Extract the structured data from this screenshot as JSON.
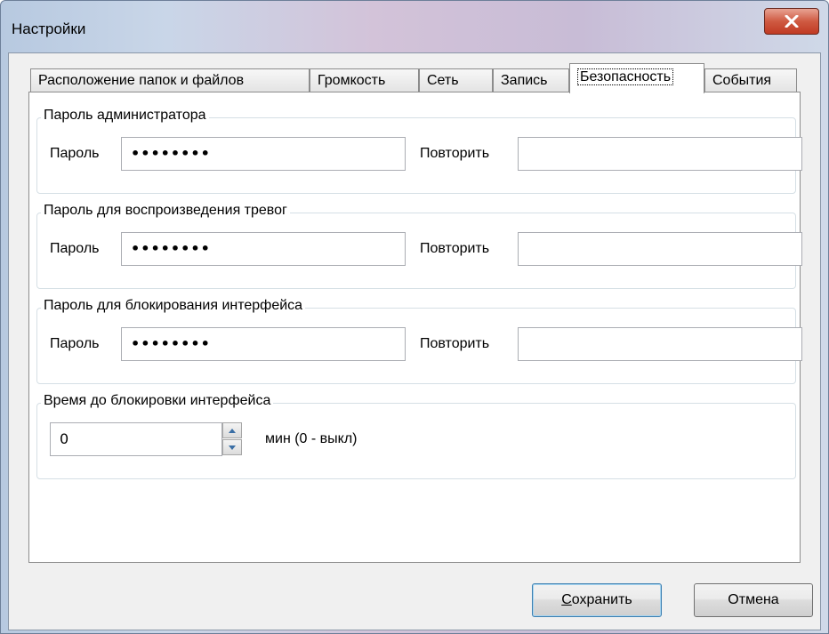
{
  "window": {
    "title": "Настройки"
  },
  "tabs": [
    {
      "label": "Расположение папок и файлов"
    },
    {
      "label": "Громкость"
    },
    {
      "label": "Сеть"
    },
    {
      "label": "Запись"
    },
    {
      "label": "Безопасность",
      "active": true
    },
    {
      "label": "События"
    }
  ],
  "groups": {
    "admin": {
      "title": "Пароль администратора",
      "password_label": "Пароль",
      "password_value": "••••••••",
      "repeat_label": "Повторить",
      "repeat_value": ""
    },
    "alarm": {
      "title": "Пароль для воспроизведения тревог",
      "password_label": "Пароль",
      "password_value": "••••••••",
      "repeat_label": "Повторить",
      "repeat_value": ""
    },
    "lock": {
      "title": "Пароль для блокирования интерфейса",
      "password_label": "Пароль",
      "password_value": "••••••••",
      "repeat_label": "Повторить",
      "repeat_value": ""
    },
    "timeout": {
      "title": "Время до блокировки интерфейса",
      "value": "0",
      "unit_label": "мин (0 - выкл)"
    }
  },
  "buttons": {
    "save_first": "С",
    "save_rest": "охранить",
    "cancel": "Отмена"
  }
}
